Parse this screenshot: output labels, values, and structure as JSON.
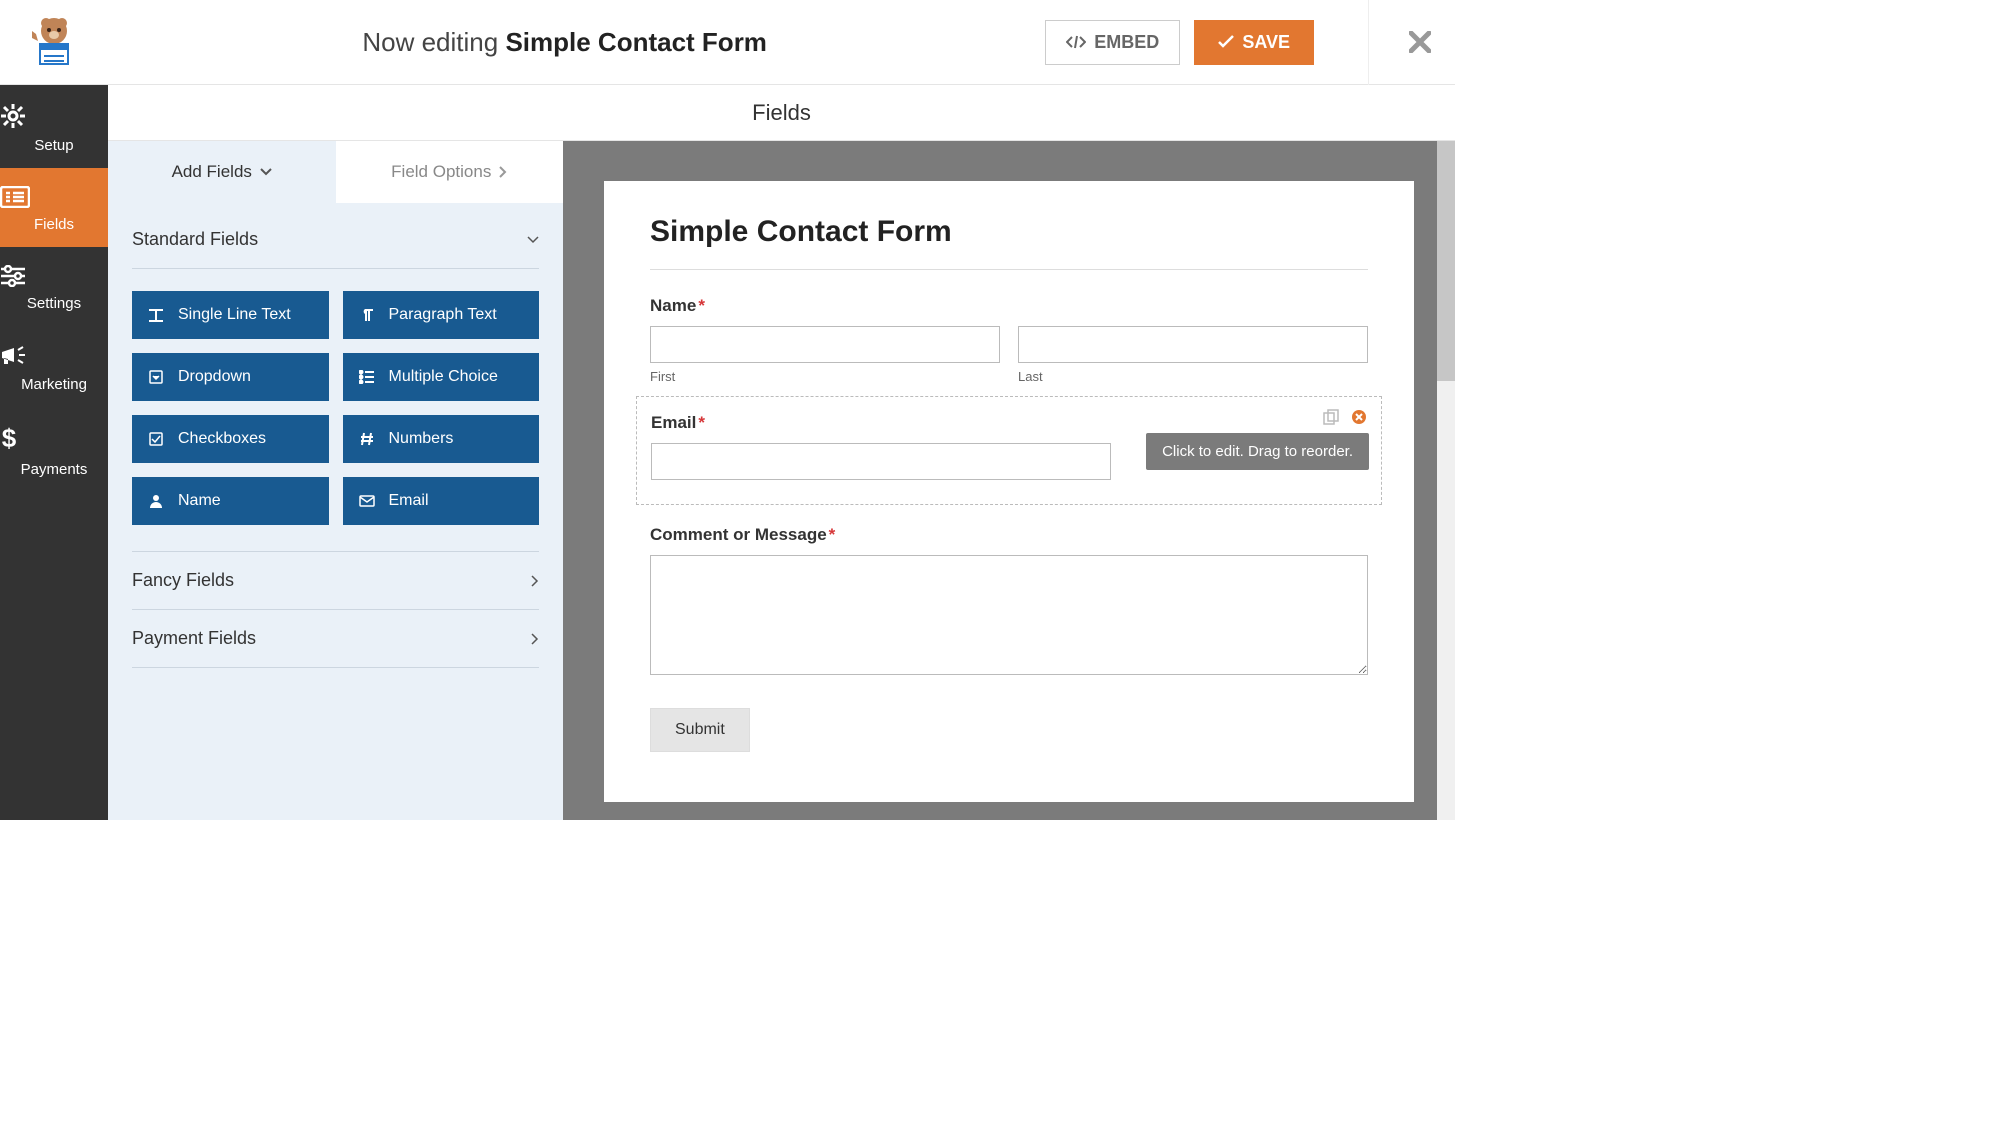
{
  "header": {
    "editing_prefix": "Now editing",
    "form_name": "Simple Contact Form",
    "embed_label": "EMBED",
    "save_label": "SAVE"
  },
  "sidebar": {
    "items": [
      {
        "label": "Setup"
      },
      {
        "label": "Fields"
      },
      {
        "label": "Settings"
      },
      {
        "label": "Marketing"
      },
      {
        "label": "Payments"
      }
    ]
  },
  "subheader": {
    "title": "Fields"
  },
  "panel": {
    "tabs": {
      "add": "Add Fields",
      "options": "Field Options"
    },
    "sections": {
      "standard": "Standard Fields",
      "fancy": "Fancy Fields",
      "payment": "Payment Fields"
    },
    "standard_fields": [
      {
        "label": "Single Line Text",
        "icon": "text"
      },
      {
        "label": "Paragraph Text",
        "icon": "para"
      },
      {
        "label": "Dropdown",
        "icon": "dropdown"
      },
      {
        "label": "Multiple Choice",
        "icon": "list"
      },
      {
        "label": "Checkboxes",
        "icon": "check"
      },
      {
        "label": "Numbers",
        "icon": "hash"
      },
      {
        "label": "Name",
        "icon": "user"
      },
      {
        "label": "Email",
        "icon": "mail"
      }
    ]
  },
  "form": {
    "title": "Simple Contact Form",
    "name_label": "Name",
    "first_sub": "First",
    "last_sub": "Last",
    "email_label": "Email",
    "comment_label": "Comment or Message",
    "submit_label": "Submit",
    "tooltip": "Click to edit. Drag to reorder."
  }
}
